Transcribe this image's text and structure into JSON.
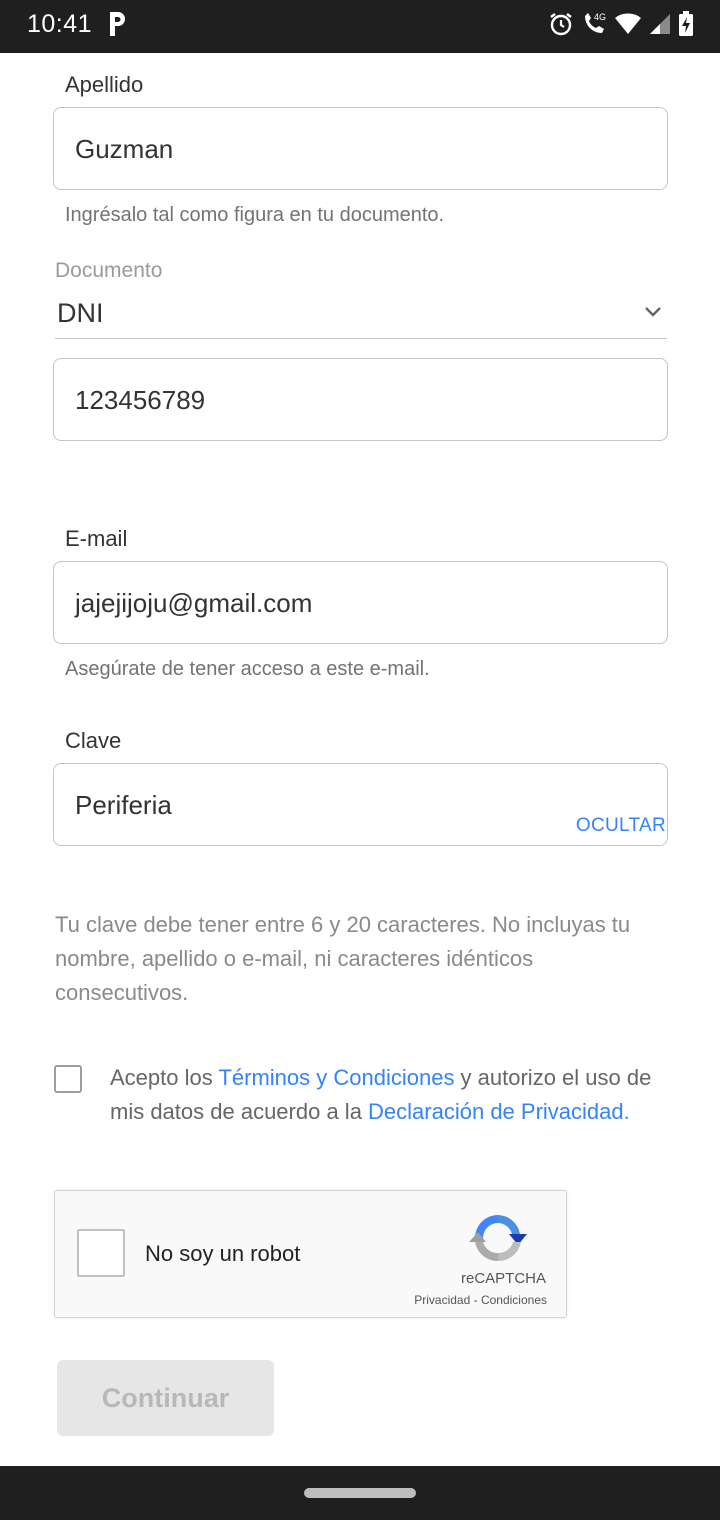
{
  "status_bar": {
    "time": "10:41",
    "left_icon": "p-app-icon",
    "icons": [
      "alarm-icon",
      "wifi-calling-4g-icon",
      "wifi-icon",
      "cell-signal-icon",
      "battery-charging-icon"
    ]
  },
  "form": {
    "last_name": {
      "label": "Apellido",
      "value": "Guzman",
      "hint": "Ingrésalo tal como figura en tu documento."
    },
    "document": {
      "label": "Documento",
      "type_value": "DNI",
      "number_value": "123456789"
    },
    "email": {
      "label": "E-mail",
      "value": "jajejijoju@gmail.com",
      "hint": "Asegúrate de tener acceso a este e-mail."
    },
    "password": {
      "label": "Clave",
      "value": "Periferia",
      "toggle_label": "OCULTAR",
      "rules": "Tu clave debe tener entre 6 y 20 caracteres. No incluyas tu nombre, apellido o e-mail, ni caracteres idénticos consecutivos."
    },
    "terms": {
      "checked": false,
      "text_1": "Acepto los ",
      "link_terms": "Términos y Condiciones",
      "text_2": " y autorizo el uso de mis datos de acuerdo a la ",
      "link_privacy": "Declaración de Privacidad",
      "text_3": "."
    },
    "recaptcha": {
      "label": "No soy un robot",
      "brand": "reCAPTCHA",
      "privacy_link": "Privacidad",
      "separator": " - ",
      "terms_link": "Condiciones"
    },
    "continue_label": "Continuar"
  },
  "colors": {
    "link": "#3483fa",
    "bar_background": "#1f1f1f",
    "button_disabled_bg": "#e6e6e6",
    "button_disabled_text": "#b8b8b8"
  }
}
